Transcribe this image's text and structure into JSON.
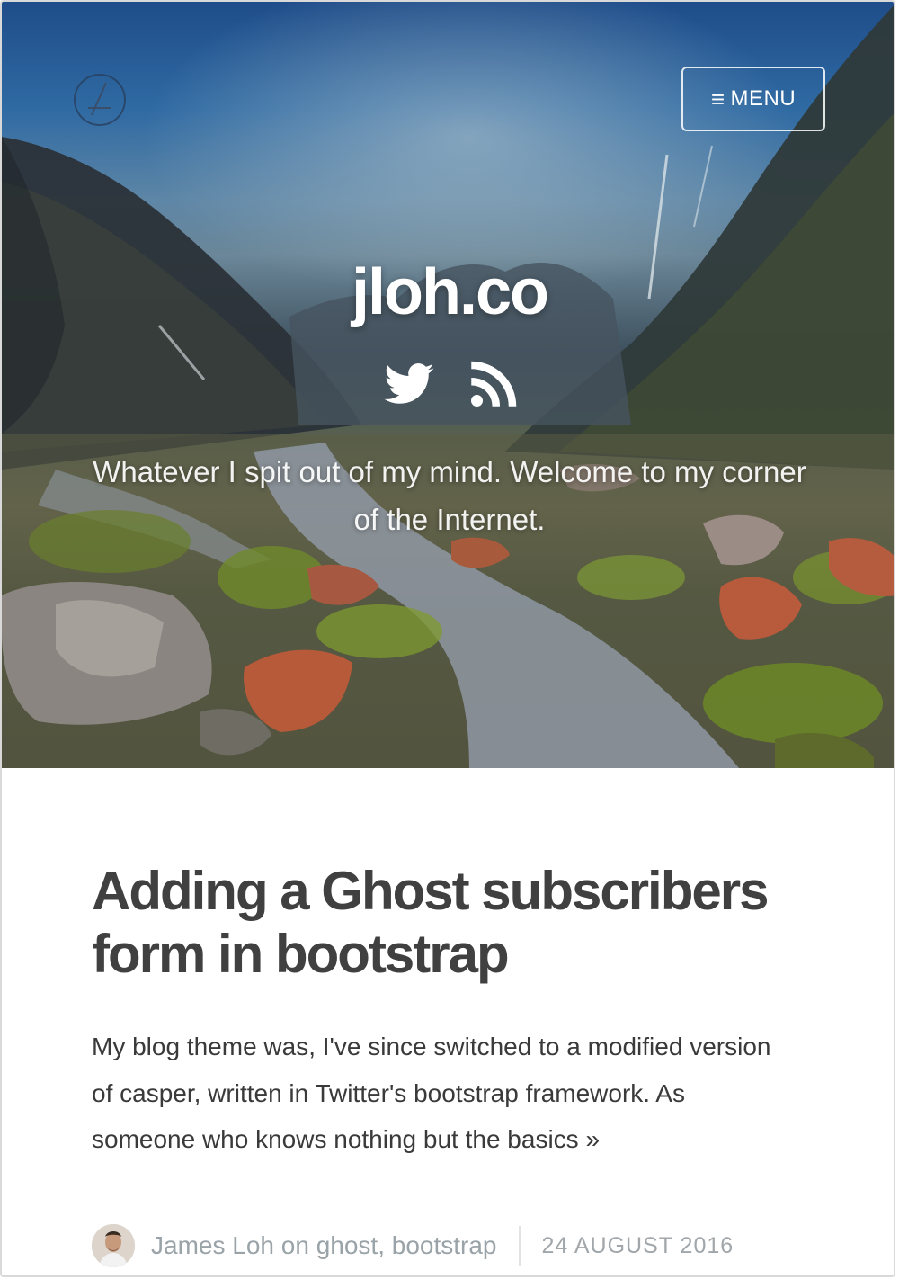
{
  "site": {
    "title": "jloh.co",
    "tagline": "Whatever I spit out of my mind. Welcome to my corner of the Internet.",
    "menu_label": "MENU"
  },
  "icons": {
    "logo": "site-logo-icon",
    "menu": "hamburger-icon",
    "twitter": "twitter-icon",
    "rss": "rss-icon"
  },
  "post": {
    "title": "Adding a Ghost subscribers form in bootstrap",
    "excerpt": "My blog theme was, I've since switched to a modified version of casper, written in Twitter's bootstrap framework. As someone who knows nothing but the basics",
    "read_more": "»",
    "author": "James Loh",
    "on_word": "on",
    "tags": [
      "ghost",
      "bootstrap"
    ],
    "date": "24 AUGUST 2016"
  },
  "colors": {
    "title_text": "#404040",
    "meta_text": "#9aa3a8",
    "hero_sky": "#2f6aa3"
  }
}
